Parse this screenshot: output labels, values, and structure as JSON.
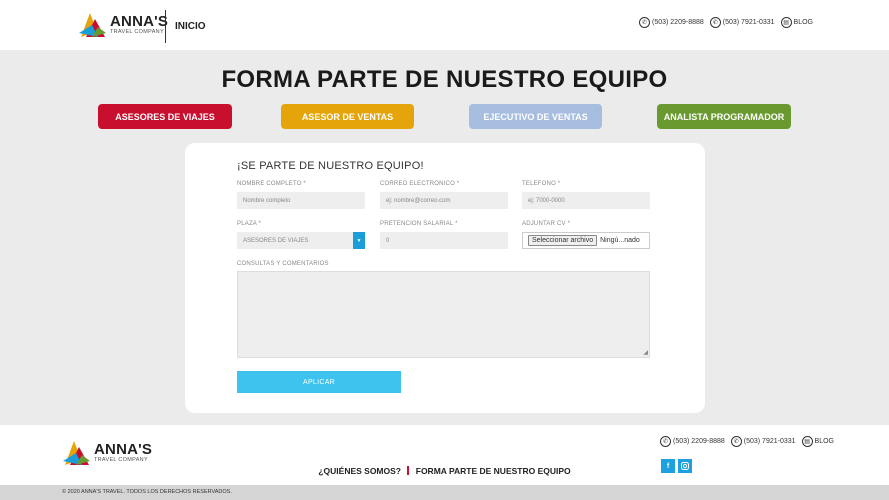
{
  "header": {
    "logo_name": "ANNA'S",
    "logo_sub": "TRAVEL COMPANY",
    "nav_inicio": "INICIO",
    "phone_1": "(503) 2209-8888",
    "phone_2": "(503) 7921-0331",
    "blog": "BLOG"
  },
  "page": {
    "title": "FORMA PARTE DE NUESTRO EQUIPO"
  },
  "tabs": [
    {
      "label": "ASESORES DE VIAJES",
      "color": "#c8102e"
    },
    {
      "label": "ASESOR DE VENTAS",
      "color": "#e5a50a"
    },
    {
      "label": "EJECUTIVO DE VENTAS",
      "color": "#a6bde0"
    },
    {
      "label": "ANALISTA PROGRAMADOR",
      "color": "#6a9a2f"
    }
  ],
  "form": {
    "title": "¡SE PARTE DE NUESTRO EQUIPO!",
    "nombre_label": "NOMBRE COMPLETO *",
    "nombre_placeholder": "Nombre completo",
    "correo_label": "CORREO ELECTRONICO *",
    "correo_placeholder": "ej: nombre@correo.com",
    "telefono_label": "TELEFONO *",
    "telefono_placeholder": "ej: 7000-0000",
    "plaza_label": "PLAZA *",
    "plaza_value": "ASESORES DE VIAJES",
    "pretencion_label": "PRETENCION SALARIAL *",
    "pretencion_placeholder": "0",
    "adjuntar_label": "ADJUNTAR CV *",
    "file_button": "Seleccionar archivo",
    "file_status": "Ningú...nado",
    "consultas_label": "CONSULTAS Y COMENTARIOS",
    "submit_label": "APLICAR"
  },
  "footer": {
    "logo_name": "ANNA'S",
    "logo_sub": "TRAVEL COMPANY",
    "link_1": "¿QUIÉNES SOMOS?",
    "link_2": "FORMA PARTE DE NUESTRO EQUIPO",
    "phone_1": "(503) 2209-8888",
    "phone_2": "(503) 7921-0331",
    "blog": "BLOG",
    "facebook": "f",
    "copyright": "© 2020 ANNA'S TRAVEL. TODOS LOS DERECHOS RESERVADOS."
  },
  "icons": [
    "phone-icon",
    "whatsapp-icon",
    "blog-icon",
    "facebook-icon",
    "instagram-icon",
    "dropdown-arrow-icon"
  ],
  "colors": {
    "accent_blue": "#3ec3ee",
    "brand_red": "#c8102e"
  }
}
